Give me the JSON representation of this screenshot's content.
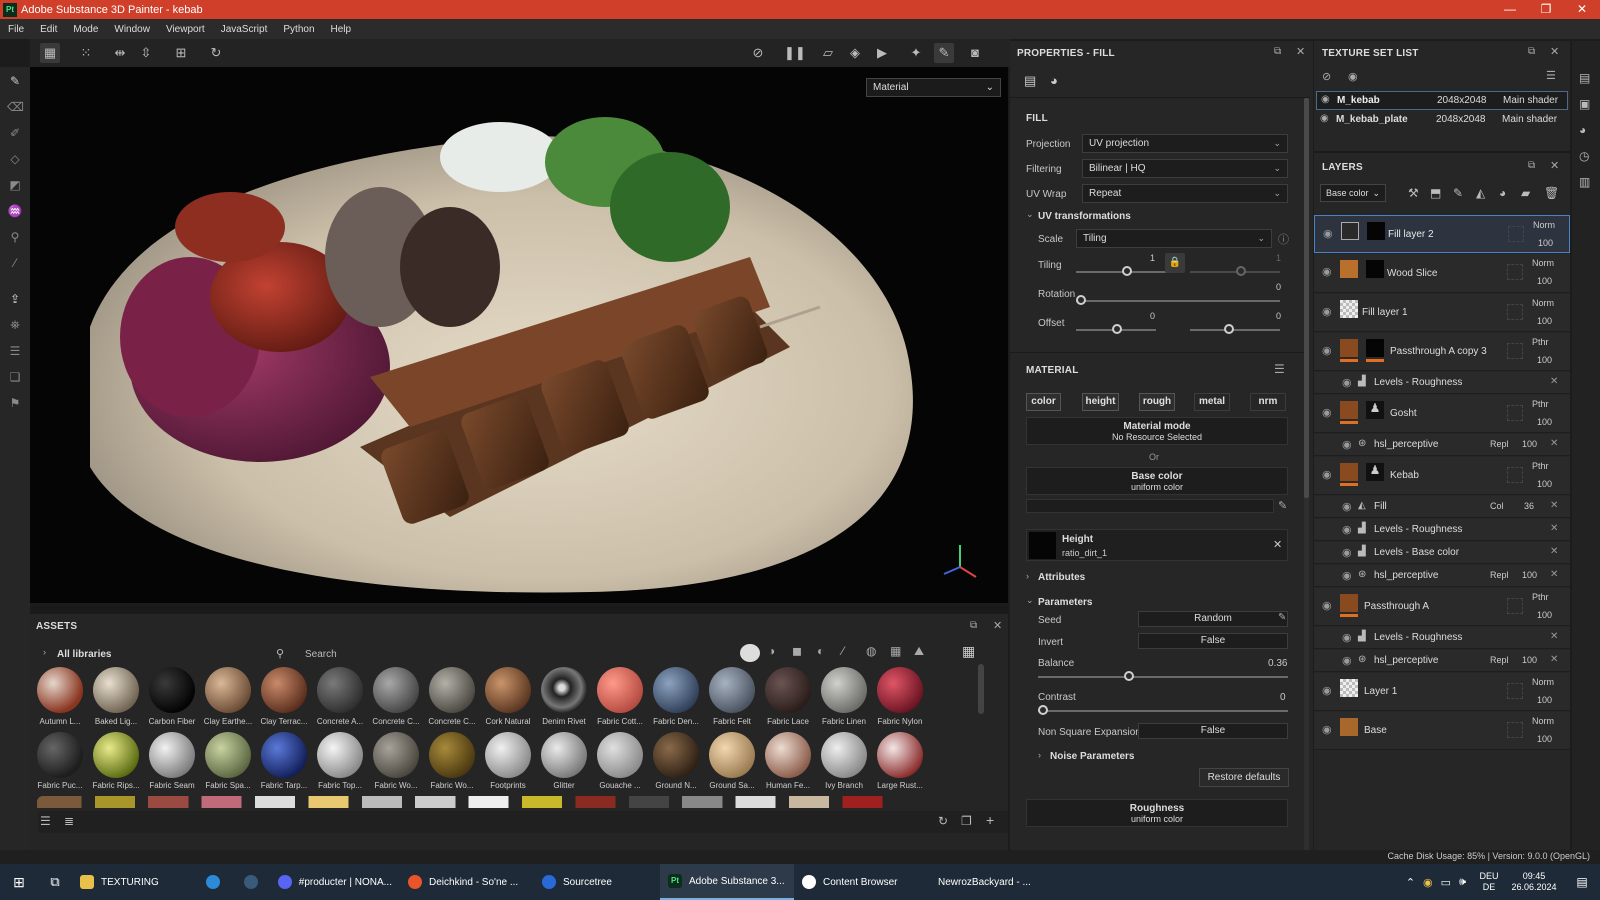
{
  "window": {
    "title": "Adobe Substance 3D Painter - kebab",
    "app_badge": "Pt",
    "min": "—",
    "max": "❐",
    "close": "✕"
  },
  "menu": [
    "File",
    "Edit",
    "Mode",
    "Window",
    "Viewport",
    "JavaScript",
    "Python",
    "Help"
  ],
  "viewport": {
    "material_select": "Material"
  },
  "properties": {
    "title": "PROPERTIES - FILL",
    "fill": "FILL",
    "projection_label": "Projection",
    "projection": "UV projection",
    "filtering_label": "Filtering",
    "filtering": "Bilinear | HQ",
    "uvwrap_label": "UV Wrap",
    "uvwrap": "Repeat",
    "uvtrans": "UV transformations",
    "scale_label": "Scale",
    "scale": "Tiling",
    "tiling_label": "Tiling",
    "tiling_val": "1",
    "tiling_val2": "1",
    "rotation_label": "Rotation",
    "rotation_val": "0",
    "offset_label": "Offset",
    "offset_val1": "0",
    "offset_val2": "0",
    "material": "MATERIAL",
    "channels": [
      "color",
      "height",
      "rough",
      "metal",
      "nrm"
    ],
    "material_mode": "Material mode",
    "no_resource": "No Resource Selected",
    "or": "Or",
    "base_color": "Base color",
    "uniform_color": "uniform color",
    "height": "Height",
    "height_res": "ratio_dirt_1",
    "attributes": "Attributes",
    "parameters": "Parameters",
    "seed_label": "Seed",
    "seed": "Random",
    "invert_label": "Invert",
    "invert": "False",
    "balance_label": "Balance",
    "balance": "0.36",
    "contrast_label": "Contrast",
    "contrast": "0",
    "nse_label": "Non Square Expansion",
    "nse": "False",
    "noise": "Noise Parameters",
    "restore": "Restore defaults",
    "roughness": "Roughness",
    "roughness_sub": "uniform color"
  },
  "texture_sets": {
    "title": "TEXTURE SET LIST",
    "items": [
      {
        "name": "M_kebab",
        "res": "2048x2048",
        "shader": "Main shader"
      },
      {
        "name": "M_kebab_plate",
        "res": "2048x2048",
        "shader": "Main shader"
      }
    ]
  },
  "layers": {
    "title": "LAYERS",
    "channel": "Base color",
    "rows": [
      {
        "name": "Fill layer 2",
        "blend": "Norm",
        "op": "100"
      },
      {
        "name": "Wood Slice",
        "blend": "Norm",
        "op": "100"
      },
      {
        "name": "Fill layer 1",
        "blend": "Norm",
        "op": "100"
      },
      {
        "name": "Passthrough A copy 3",
        "blend": "Pthr",
        "op": "100"
      },
      {
        "name": "Levels - Roughness",
        "blend": "",
        "op": ""
      },
      {
        "name": "Gosht",
        "blend": "Pthr",
        "op": "100"
      },
      {
        "name": "hsl_perceptive",
        "blend": "Repl",
        "op": "100"
      },
      {
        "name": "Kebab",
        "blend": "Pthr",
        "op": "100"
      },
      {
        "name": "Fill",
        "blend": "Col",
        "op": "36"
      },
      {
        "name": "Levels - Roughness",
        "blend": "",
        "op": ""
      },
      {
        "name": "Levels - Base color",
        "blend": "",
        "op": ""
      },
      {
        "name": "hsl_perceptive",
        "blend": "Repl",
        "op": "100"
      },
      {
        "name": "Passthrough A",
        "blend": "Pthr",
        "op": "100"
      },
      {
        "name": "Levels - Roughness",
        "blend": "",
        "op": ""
      },
      {
        "name": "hsl_perceptive",
        "blend": "Repl",
        "op": "100"
      },
      {
        "name": "Layer 1",
        "blend": "Norm",
        "op": "100"
      },
      {
        "name": "Base",
        "blend": "Norm",
        "op": "100"
      }
    ]
  },
  "assets": {
    "title": "ASSETS",
    "libraries": "All libraries",
    "search": "Search",
    "row1": [
      "Autumn L...",
      "Baked Lig...",
      "Carbon Fiber",
      "Clay Earthe...",
      "Clay Terrac...",
      "Concrete A...",
      "Concrete C...",
      "Concrete C...",
      "Cork Natural",
      "Denim Rivet",
      "Fabric Cott...",
      "Fabric Den...",
      "Fabric Felt",
      "Fabric Lace",
      "Fabric Linen",
      "Fabric Nylon"
    ],
    "row2": [
      "Fabric Puc...",
      "Fabric Rips...",
      "Fabric Seam",
      "Fabric Spa...",
      "Fabric Tarp...",
      "Fabric Top...",
      "Fabric Wo...",
      "Fabric Wo...",
      "Footprints",
      "Glitter",
      "Gouache ...",
      "Ground N...",
      "Ground Sa...",
      "Human Fe...",
      "Ivy Branch",
      "Large Rust..."
    ]
  },
  "status": {
    "text": "Cache Disk Usage:   85%  |  Version: 9.0.0 (OpenGL)"
  },
  "taskbar": {
    "items": [
      "TEXTURING",
      "#producter | NONA...",
      "Deichkind - So'ne ...",
      "Sourcetree",
      "Adobe Substance 3...",
      "Content Browser",
      "NewrozBackyard - ..."
    ],
    "lang1": "DEU",
    "lang2": "DE",
    "time": "09:45",
    "date": "26.06.2024"
  }
}
